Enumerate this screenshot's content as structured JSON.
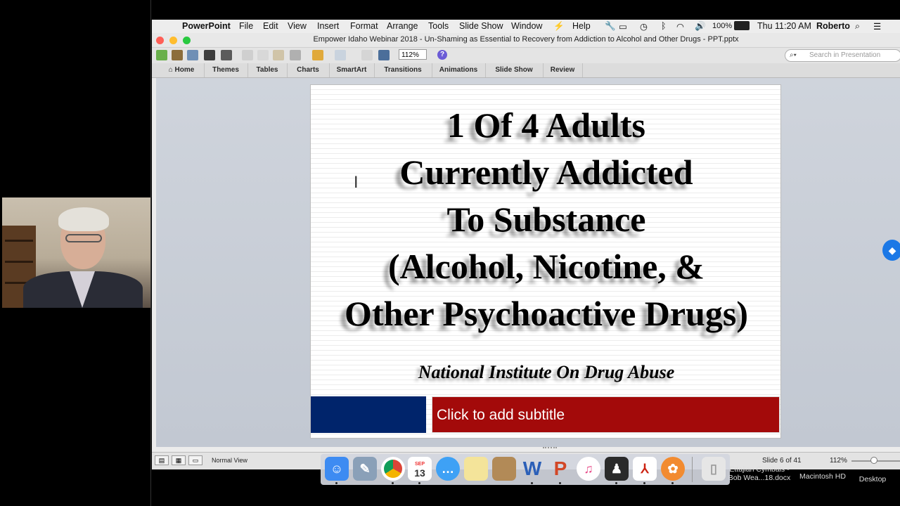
{
  "menubar": {
    "apple": "",
    "app_name": "PowerPoint",
    "items": [
      "File",
      "Edit",
      "View",
      "Insert",
      "Format",
      "Arrange",
      "Tools",
      "Slide Show",
      "Window",
      "Help"
    ],
    "battery": "100%",
    "clock": "Thu 11:20 AM",
    "user": "Roberto"
  },
  "window": {
    "title": "Empower Idaho Webinar 2018 - Un-Shaming as Essential to Recovery from Addiction to Alcohol and Other Drugs - PPT.pptx"
  },
  "toolbar": {
    "zoom": "112%",
    "help": "?",
    "search_placeholder": "Search in Presentation"
  },
  "ribbon": {
    "tabs": [
      "Home",
      "Themes",
      "Tables",
      "Charts",
      "SmartArt",
      "Transitions",
      "Animations",
      "Slide Show",
      "Review"
    ]
  },
  "slide": {
    "lines": [
      "1 Of 4 Adults",
      "Currently Addicted",
      "To Substance",
      "(Alcohol, Nicotine, &",
      "Other Psychoactive Drugs)"
    ],
    "attribution": "National Institute On Drug Abuse",
    "subtitle_placeholder": "Click to add subtitle"
  },
  "statusbar": {
    "view": "Normal View",
    "slide_counter": "Slide 6 of 41",
    "zoom": "112%",
    "zoom_level": 0.55
  },
  "dock": {
    "calendar_month": "SEP",
    "calendar_day": "13",
    "word_letter": "W",
    "ppt_letter": "P"
  },
  "desktop": {
    "file_label_1": "Ettajian Cymbals -",
    "file_label_2": "Bob Wea...18.docx",
    "drive": "Macintosh HD",
    "desktop": "Desktop"
  }
}
